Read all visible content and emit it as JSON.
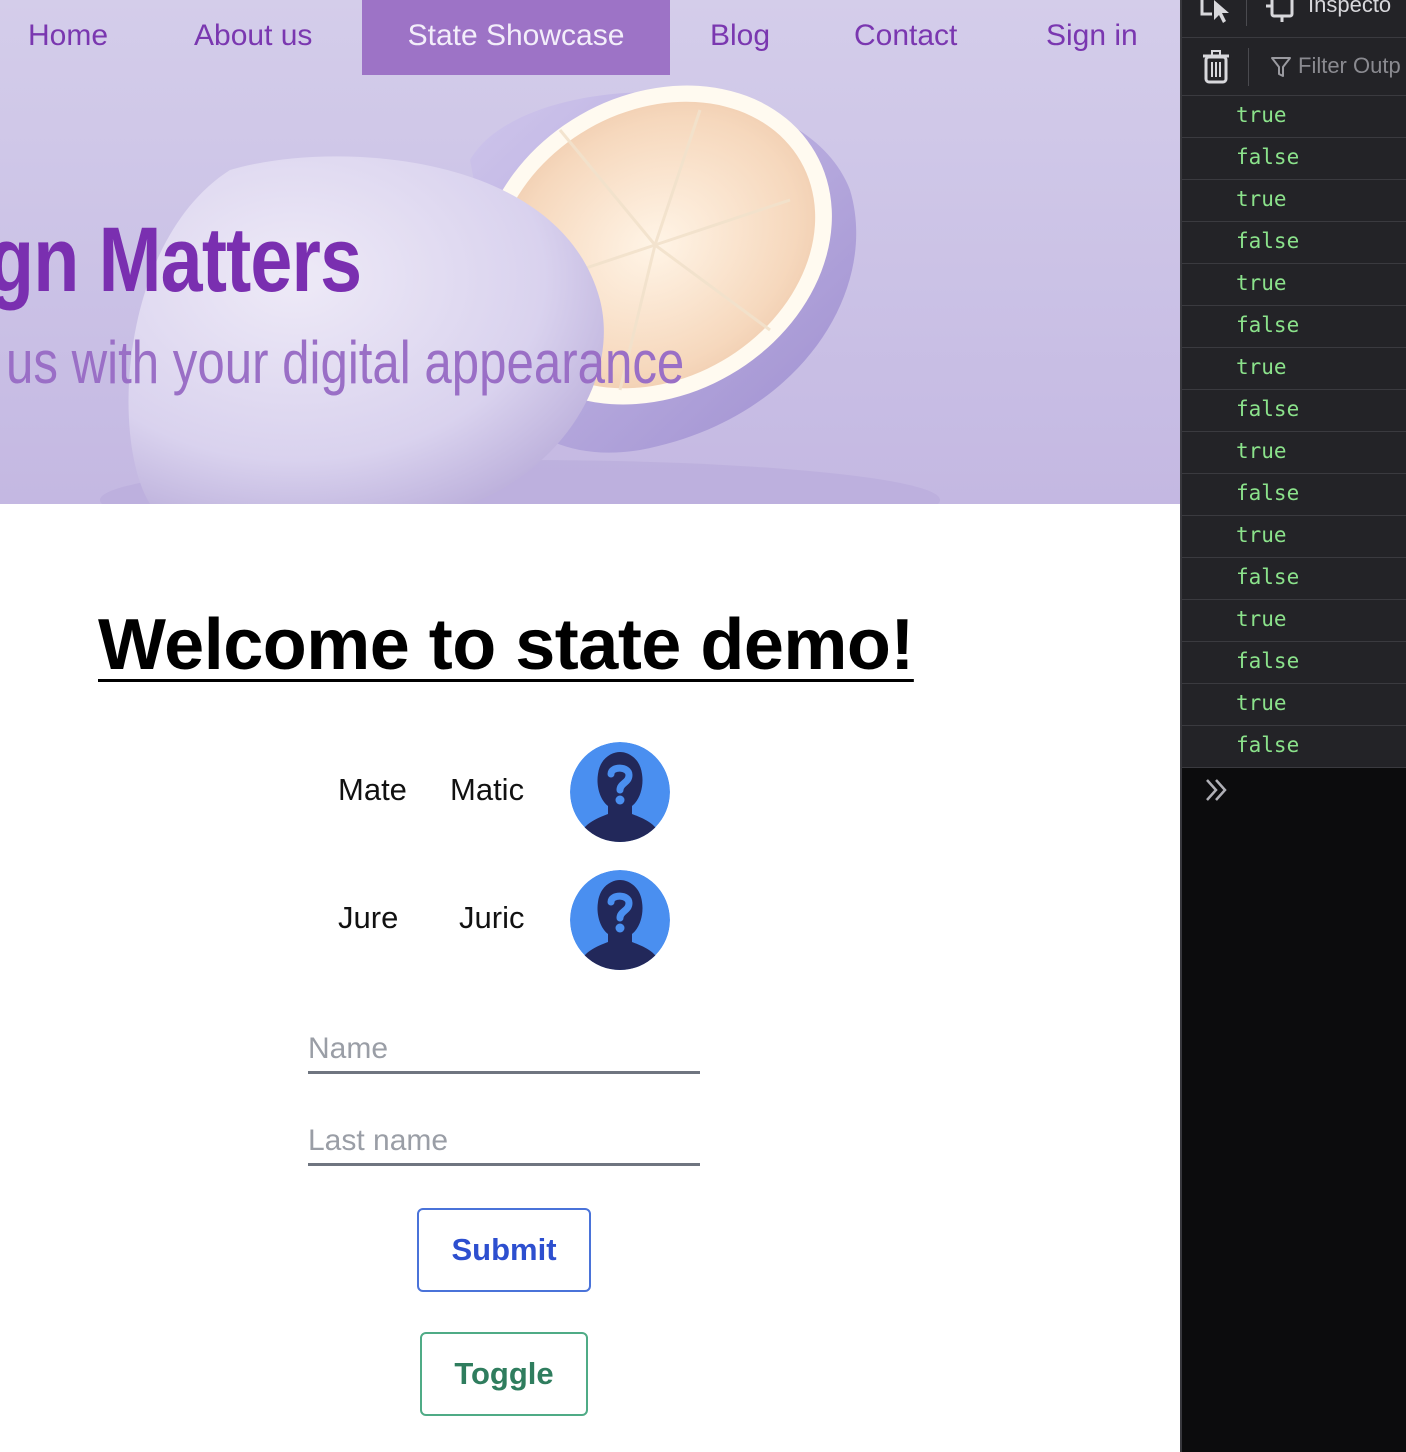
{
  "nav": {
    "items": [
      {
        "label": "Home"
      },
      {
        "label": "About us"
      },
      {
        "label": "State Showcase",
        "active": true
      },
      {
        "label": "Blog"
      },
      {
        "label": "Contact"
      },
      {
        "label": "Sign in"
      }
    ]
  },
  "hero": {
    "title": "gn Matters",
    "subtitle": "us with your digital appearance"
  },
  "main": {
    "heading": "Welcome to state demo!",
    "people": [
      {
        "first": "Mate",
        "last": "Matic",
        "avatar_icon": "unknown-user-icon"
      },
      {
        "first": "Jure",
        "last": "Juric",
        "avatar_icon": "unknown-user-icon"
      }
    ],
    "form": {
      "name_placeholder": "Name",
      "lastname_placeholder": "Last name",
      "submit_label": "Submit",
      "toggle_label": "Toggle"
    }
  },
  "devtools": {
    "inspector_tab": "Inspecto",
    "filter_placeholder": "Filter Outp",
    "console_log": [
      "true",
      "false",
      "true",
      "false",
      "true",
      "false",
      "true",
      "false",
      "true",
      "false",
      "true",
      "false",
      "true",
      "false",
      "true",
      "false"
    ]
  },
  "colors": {
    "nav_text": "#7a37b0",
    "nav_active_bg": "#9d73c6",
    "hero_title": "#7a2fb0",
    "hero_subtitle": "#9a6fc6",
    "submit_border": "#4a73d9",
    "toggle_border": "#4fab86",
    "avatar_bg": "#4a8ff0",
    "avatar_silhouette": "#22285a",
    "console_value": "#8be28b"
  }
}
